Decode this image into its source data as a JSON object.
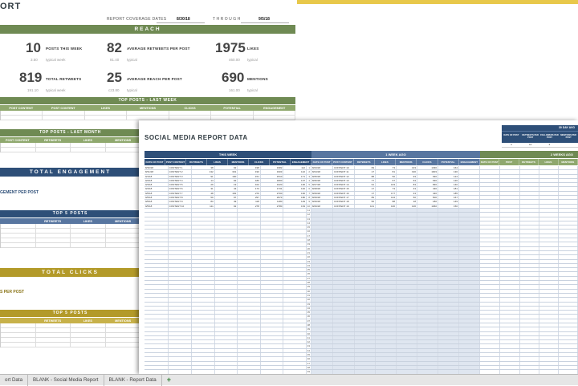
{
  "report": {
    "title": "ORT",
    "coverage_label": "REPORT COVERAGE DATES",
    "coverage_start": "8/30/18",
    "through_label": "THROUGH",
    "coverage_end": "9/5/18"
  },
  "reach": {
    "title": "REACH",
    "metrics": [
      {
        "value": "10",
        "label": "POSTS THIS WEEK",
        "sub_value": "3.50",
        "sub_label": "typical week"
      },
      {
        "value": "82",
        "label": "AVERAGE RETWEETS PER POST",
        "sub_value": "81.40",
        "sub_label": "typical"
      },
      {
        "value": "1975",
        "label": "LIKES",
        "sub_value": "460.00",
        "sub_label": "typical"
      },
      {
        "value": "819",
        "label": "TOTAL RETWEETS",
        "sub_value": "191.10",
        "sub_label": "typical week"
      },
      {
        "value": "25",
        "label": "AVERAGE REACH PER POST",
        "sub_value": "c23.80",
        "sub_label": "typical"
      },
      {
        "value": "690",
        "label": "MENTIONS",
        "sub_value": "161.00",
        "sub_label": "typical"
      }
    ]
  },
  "top_posts_week": {
    "title": "TOP POSTS - LAST WEEK",
    "columns": [
      "POST CONTENT",
      "POST CONTENT",
      "LIKES",
      "MENTIONS",
      "CLICKS",
      "POTENTIAL",
      "ENGAGEMENT"
    ]
  },
  "top_posts_month": {
    "title": "TOP POSTS - LAST MONTH",
    "columns": [
      "POST CONTENT",
      "RETWEETS",
      "LIKES",
      "MENTIONS"
    ]
  },
  "engagement": {
    "title": "TOTAL ENGAGEMENT",
    "label": "GEMENT PER POST"
  },
  "top5_blue": {
    "title": "TOP 5 POSTS",
    "columns": [
      "RETWEETS",
      "LIKES",
      "MENTIONS"
    ]
  },
  "clicks": {
    "title": "TOTAL CLICKS",
    "label": "S PER POST"
  },
  "top5_gold": {
    "title": "TOP 5 POSTS",
    "columns": [
      "RETWEETS",
      "LIKES",
      "MENTIONS"
    ]
  },
  "data_sheet": {
    "title": "SOCIAL MEDIA REPORT DATA",
    "this_week": "THIS WEEK",
    "week_ago": "1 WEEK AGO",
    "two_weeks_ago": "2 WEEKS AGO",
    "columns": [
      "DATE OF POST",
      "POST CONTENT",
      "RETWEETS",
      "LIKES",
      "MENTIONS",
      "CLICKS",
      "POTENTIAL",
      "ENGAGEMENT"
    ],
    "avg_title": "30 DAY AVG",
    "avg_columns": [
      "DATE OF POST",
      "RETWEETS PER POST",
      "FOLLOWERS PER POST",
      "MENTIONS PER POST"
    ],
    "avg_values": [
      "4",
      "10",
      "3",
      ""
    ],
    "this_week_rows": [
      [
        "8/30/18",
        "CONTENT 1",
        "38",
        "92",
        "198",
        "1982",
        "112"
      ],
      [
        "8/31/18",
        "CONTENT 2",
        "132",
        "301",
        "190",
        "1903",
        "142"
      ],
      [
        "9/1/18",
        "CONTENT 3",
        "91",
        "190",
        "151",
        "1510",
        "171"
      ],
      [
        "9/2/18",
        "CONTENT 4",
        "14",
        "92",
        "180",
        "1800",
        "137"
      ],
      [
        "9/3/18",
        "CONTENT 5",
        "29",
        "19",
        "102",
        "1020",
        "100"
      ],
      [
        "9/4/18",
        "CONTENT 6",
        "31",
        "43",
        "173",
        "1731",
        "140"
      ],
      [
        "9/5/18",
        "CONTENT 7",
        "48",
        "181",
        "270",
        "2700",
        "160"
      ],
      [
        "9/5/18",
        "CONTENT 8",
        "59",
        "97",
        "297",
        "2973",
        "180"
      ],
      [
        "9/5/18",
        "CONTENT 9",
        "83",
        "49",
        "118",
        "1180",
        "129"
      ],
      [
        "9/5/18",
        "CONTENT 10",
        "111",
        "92",
        "278",
        "2780",
        "163"
      ]
    ],
    "week_ago_rows": [
      [
        "8/23/18",
        "CONTENT 10",
        "69",
        "73",
        "133",
        "1330",
        "164"
      ],
      [
        "8/24/18",
        "CONTENT 11",
        "17",
        "81",
        "190",
        "1903",
        "130"
      ],
      [
        "8/25/18",
        "CONTENT 12",
        "88",
        "50",
        "93",
        "930",
        "124"
      ],
      [
        "8/26/18",
        "CONTENT 13",
        "77",
        "67",
        "63",
        "630",
        "120"
      ],
      [
        "8/27/18",
        "CONTENT 14",
        "91",
        "103",
        "83",
        "830",
        "140"
      ],
      [
        "8/28/18",
        "CONTENT 15",
        "17",
        "73",
        "43",
        "430",
        "181"
      ],
      [
        "8/29/18",
        "CONTENT 16",
        "17",
        "177",
        "43",
        "430",
        "185"
      ],
      [
        "8/29/18",
        "CONTENT 17",
        "89",
        "134",
        "50",
        "500",
        "167"
      ],
      [
        "8/29/18",
        "CONTENT 18",
        "56",
        "88",
        "18",
        "180",
        "149"
      ],
      [
        "8/29/18",
        "CONTENT 19",
        "101",
        "100",
        "106",
        "1060",
        "150"
      ]
    ],
    "row_numbers": [
      "1",
      "2",
      "3",
      "4",
      "5",
      "6",
      "7",
      "8",
      "9",
      "10",
      "11",
      "12",
      "13",
      "14",
      "15",
      "16",
      "17",
      "18",
      "19",
      "20",
      "21",
      "22",
      "23",
      "24",
      "25",
      "26",
      "27",
      "28",
      "29",
      "30",
      "31",
      "32",
      "33",
      "34",
      "35",
      "36",
      "37",
      "38",
      "39",
      "40",
      "41",
      "42",
      "43",
      "44",
      "45",
      "46",
      "47",
      "48",
      "49",
      "50",
      "51"
    ]
  },
  "tabs": [
    "ort Data",
    "BLANK - Social Media Report",
    "BLANK - Report Data",
    "+"
  ]
}
